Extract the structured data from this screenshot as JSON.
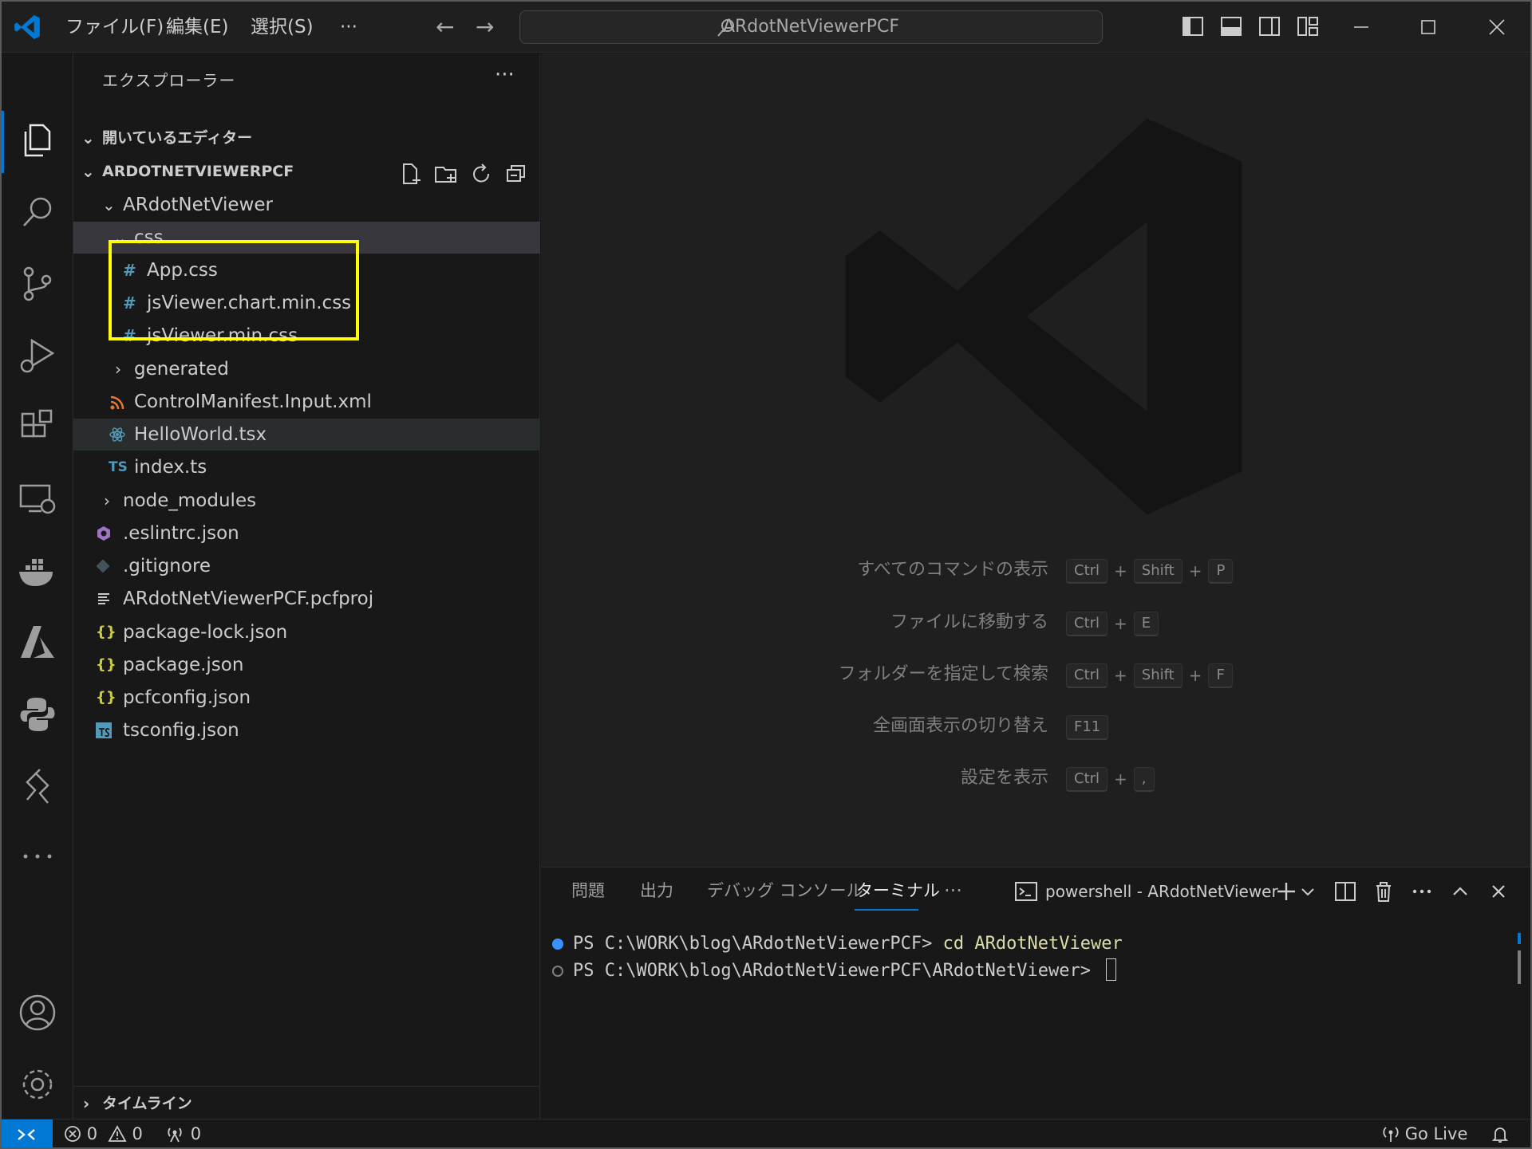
{
  "titlebar": {
    "menus": [
      "ファイル(F)",
      "編集(E)",
      "選択(S)",
      "···"
    ],
    "back": "←",
    "forward": "→",
    "search": "ARdotNetViewerPCF"
  },
  "sidebar": {
    "title": "エクスプローラー",
    "more": "···",
    "open_editors": "開いているエディター",
    "project": "ARDOTNETVIEWERPCF",
    "tree": [
      {
        "label": "ARdotNetViewer",
        "chev": "⌄",
        "icon": ""
      },
      {
        "label": "css",
        "chev": "⌄",
        "icon": ""
      },
      {
        "label": "App.css",
        "chev": "",
        "icon": "#"
      },
      {
        "label": "jsViewer.chart.min.css",
        "chev": "",
        "icon": "#"
      },
      {
        "label": "jsViewer.min.css",
        "chev": "",
        "icon": "#"
      },
      {
        "label": "generated",
        "chev": "›",
        "icon": ""
      },
      {
        "label": "ControlManifest.Input.xml",
        "chev": "",
        "icon": "rss-icon"
      },
      {
        "label": "HelloWorld.tsx",
        "chev": "",
        "icon": "react-icon"
      },
      {
        "label": "index.ts",
        "chev": "",
        "icon": "TS"
      },
      {
        "label": "node_modules",
        "chev": "›",
        "icon": ""
      },
      {
        "label": ".eslintrc.json",
        "chev": "",
        "icon": "eslint-icon"
      },
      {
        "label": ".gitignore",
        "chev": "",
        "icon": "git-icon"
      },
      {
        "label": "ARdotNetViewerPCF.pcfproj",
        "chev": "",
        "icon": "lines-icon"
      },
      {
        "label": "package-lock.json",
        "chev": "",
        "icon": "{}"
      },
      {
        "label": "package.json",
        "chev": "",
        "icon": "{}"
      },
      {
        "label": "pcfconfig.json",
        "chev": "",
        "icon": "{}"
      },
      {
        "label": "tsconfig.json",
        "chev": "",
        "icon": "ts-box-icon"
      }
    ],
    "timeline": "タイムライン"
  },
  "editor": {
    "shortcuts": [
      {
        "label": "すべてのコマンドの表示",
        "keys": [
          "Ctrl",
          "Shift",
          "P"
        ]
      },
      {
        "label": "ファイルに移動する",
        "keys": [
          "Ctrl",
          "E"
        ]
      },
      {
        "label": "フォルダーを指定して検索",
        "keys": [
          "Ctrl",
          "Shift",
          "F"
        ]
      },
      {
        "label": "全画面表示の切り替え",
        "keys": [
          "F11"
        ]
      },
      {
        "label": "設定を表示",
        "keys": [
          "Ctrl",
          ","
        ]
      }
    ]
  },
  "panel": {
    "tabs": [
      "問題",
      "出力",
      "デバッグ コンソール",
      "ターミナル",
      "···"
    ],
    "active_tab": "ターミナル",
    "terminal_name": "powershell - ARdotNetViewer",
    "lines": [
      {
        "prompt": "PS C:\\WORK\\blog\\ARdotNetViewerPCF> ",
        "cmd": "cd ARdotNetViewer"
      },
      {
        "prompt": "PS C:\\WORK\\blog\\ARdotNetViewerPCF\\ARdotNetViewer> ",
        "cmd": ""
      }
    ]
  },
  "statusbar": {
    "errors": "0",
    "warnings": "0",
    "ports": "0",
    "golive": "Go Live"
  },
  "colors": {
    "accent": "#0078d4",
    "highlight": "#ffff00",
    "css_icon": "#519aba",
    "json_icon": "#cbcb41",
    "ts_icon": "#519aba",
    "xml_icon": "#e37933",
    "eslint_icon": "#a074c4"
  }
}
